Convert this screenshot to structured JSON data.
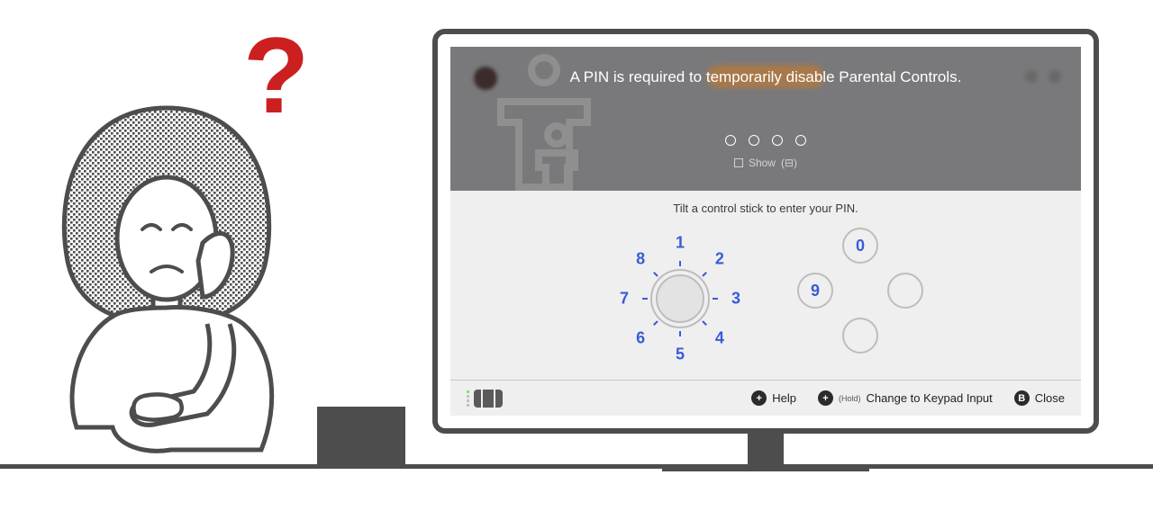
{
  "questionMark": "?",
  "header": {
    "title": "A PIN is required to temporarily disable Parental Controls.",
    "pinLength": 4,
    "showLabel": "Show",
    "showHint": "(⊟)"
  },
  "body": {
    "instruction": "Tilt a control stick to enter your PIN.",
    "dialNumbers": [
      "1",
      "2",
      "3",
      "4",
      "5",
      "6",
      "7",
      "8"
    ],
    "dpad": {
      "top": "0",
      "left": "9",
      "right": "",
      "bottom": ""
    }
  },
  "footer": {
    "helpGlyph": "+",
    "helpLabel": "Help",
    "changeGlyph": "+",
    "changeHold": "(Hold)",
    "changeLabel": "Change to Keypad Input",
    "closeGlyph": "B",
    "closeLabel": "Close"
  }
}
